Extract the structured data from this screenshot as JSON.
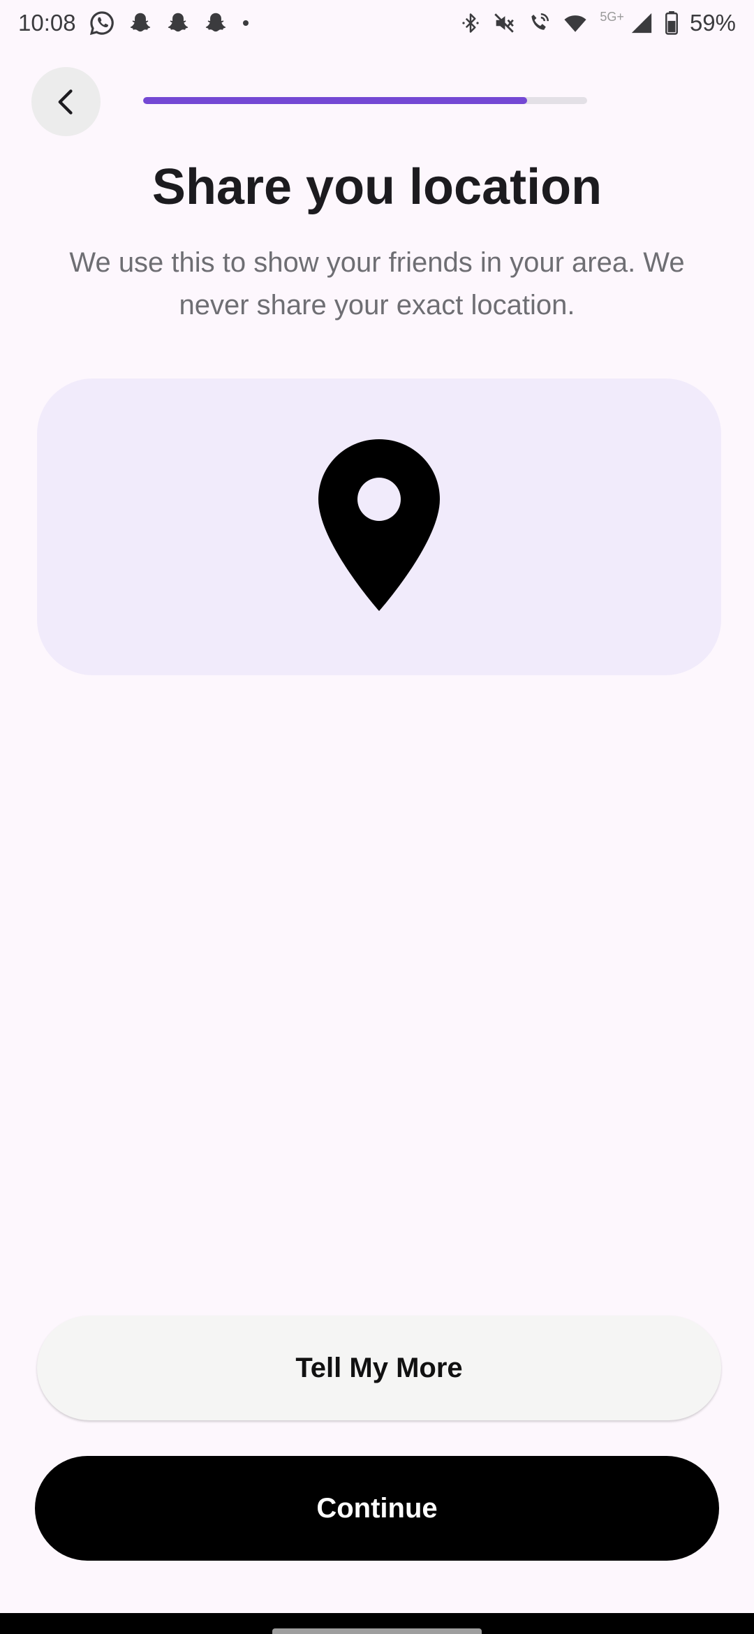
{
  "status_bar": {
    "time": "10:08",
    "network": "5G+",
    "battery": "59%",
    "left_icons": [
      "whatsapp-icon",
      "snapchat-icon",
      "snapchat-icon",
      "snapchat-icon",
      "dot-icon"
    ],
    "right_icons": [
      "bluetooth-icon",
      "mute-icon",
      "wifi-calling-icon",
      "wifi-icon",
      "signal-icon",
      "battery-icon"
    ]
  },
  "progress": {
    "fraction": 0.865,
    "fill_color": "#7448d4",
    "track_color": "#e3e0e6"
  },
  "header": {
    "title": "Share you location",
    "subtitle": "We use this to show your friends in your area. We never share your exact location."
  },
  "illustration": {
    "icon": "location-pin-icon",
    "background_color": "#f1ebfb"
  },
  "actions": {
    "secondary_label": "Tell My More",
    "primary_label": "Continue"
  },
  "colors": {
    "page_background": "#fdf7fd",
    "primary_button": "#000000",
    "secondary_button": "#f5f5f4"
  }
}
